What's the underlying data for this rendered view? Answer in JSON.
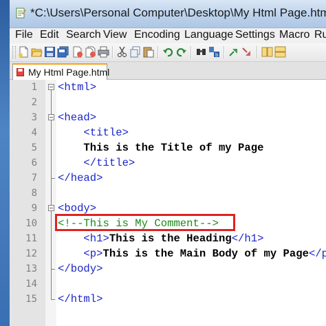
{
  "window": {
    "title": "*C:\\Users\\Personal Computer\\Desktop\\My Html Page.html - Notepad++"
  },
  "menu": [
    "File",
    "Edit",
    "Search",
    "View",
    "Encoding",
    "Language",
    "Settings",
    "Macro",
    "Ru"
  ],
  "toolbar": {
    "icons": [
      "new-file-icon",
      "open-file-icon",
      "save-icon",
      "save-all-icon",
      "close-icon",
      "close-all-icon",
      "print-icon",
      "cut-icon",
      "copy-icon",
      "paste-icon",
      "undo-icon",
      "redo-icon",
      "find-icon",
      "replace-icon",
      "zoom-in-icon",
      "zoom-out-icon",
      "sync-v-icon",
      "sync-h-icon"
    ]
  },
  "tab": {
    "label": "My Html Page.html",
    "modified": true
  },
  "editor": {
    "lines": [
      {
        "n": "1",
        "parts": [
          {
            "c": "tag",
            "t": "<html>"
          }
        ]
      },
      {
        "n": "2",
        "parts": []
      },
      {
        "n": "3",
        "parts": [
          {
            "c": "tag",
            "t": "<head>"
          }
        ]
      },
      {
        "n": "4",
        "parts": [
          {
            "c": "tag",
            "t": "    <title>"
          }
        ]
      },
      {
        "n": "5",
        "parts": [
          {
            "c": "txt",
            "t": "    This is the Title of my Page"
          }
        ]
      },
      {
        "n": "6",
        "parts": [
          {
            "c": "tag",
            "t": "    </title>"
          }
        ]
      },
      {
        "n": "7",
        "parts": [
          {
            "c": "tag",
            "t": "</head>"
          }
        ]
      },
      {
        "n": "8",
        "parts": []
      },
      {
        "n": "9",
        "parts": [
          {
            "c": "tag",
            "t": "<body>"
          }
        ]
      },
      {
        "n": "10",
        "parts": [
          {
            "c": "cmt",
            "t": "<!--This is My Comment-->"
          }
        ]
      },
      {
        "n": "11",
        "parts": [
          {
            "c": "tag",
            "t": "    <h1>"
          },
          {
            "c": "txt",
            "t": "This is the Heading"
          },
          {
            "c": "tag",
            "t": "</h1>"
          }
        ]
      },
      {
        "n": "12",
        "parts": [
          {
            "c": "tag",
            "t": "    <p>"
          },
          {
            "c": "txt",
            "t": "This is the Main Body of my Page"
          },
          {
            "c": "tag",
            "t": "</p>"
          }
        ]
      },
      {
        "n": "13",
        "parts": [
          {
            "c": "tag",
            "t": "</body>"
          }
        ]
      },
      {
        "n": "14",
        "parts": []
      },
      {
        "n": "15",
        "parts": [
          {
            "c": "tag",
            "t": "</html>"
          }
        ]
      }
    ]
  },
  "colors": {
    "tag": "#1b26c9",
    "text": "#000000",
    "comment": "#1a8a1a",
    "highlight_border": "#e02121",
    "active_tab_accent": "#f5a31a"
  }
}
